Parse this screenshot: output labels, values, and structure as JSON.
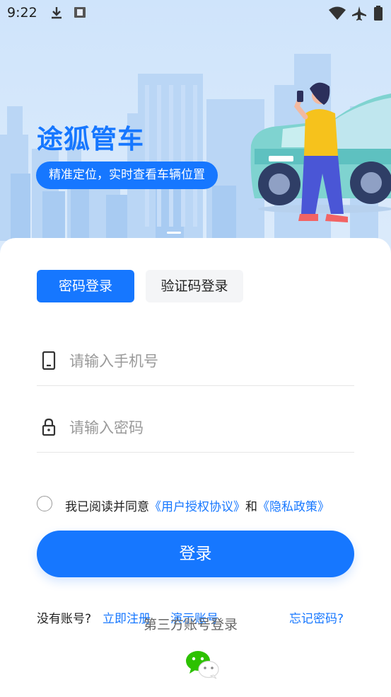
{
  "status_bar": {
    "time": "9:22",
    "left_icons": [
      "download-icon",
      "keyboard-icon"
    ],
    "right_icons": [
      "wifi-icon",
      "airplane-icon",
      "battery-icon"
    ]
  },
  "hero": {
    "title": "途狐管车",
    "slogan": "精准定位，实时查看车辆位置"
  },
  "tabs": [
    {
      "label": "密码登录",
      "active": true
    },
    {
      "label": "验证码登录",
      "active": false
    }
  ],
  "form": {
    "phone": {
      "placeholder": "请输入手机号",
      "value": "",
      "icon": "phone-icon"
    },
    "password": {
      "placeholder": "请输入密码",
      "value": "",
      "icon": "lock-icon"
    }
  },
  "agreement": {
    "checked": false,
    "prefix": "我已阅读并同意",
    "user_agreement": "《用户授权协议》",
    "conjunction": "和",
    "privacy_policy": "《隐私政策》"
  },
  "login_button": "登录",
  "links": {
    "no_account": "没有账号?",
    "register": "立即注册",
    "demo": "演示账号",
    "forgot": "忘记密码?"
  },
  "third_party": {
    "label": "第三方账号登录",
    "providers": [
      "wechat-icon"
    ]
  },
  "colors": {
    "accent": "#1677ff",
    "hero_background": "#d6e8fb",
    "placeholder": "#9a9a9a"
  }
}
